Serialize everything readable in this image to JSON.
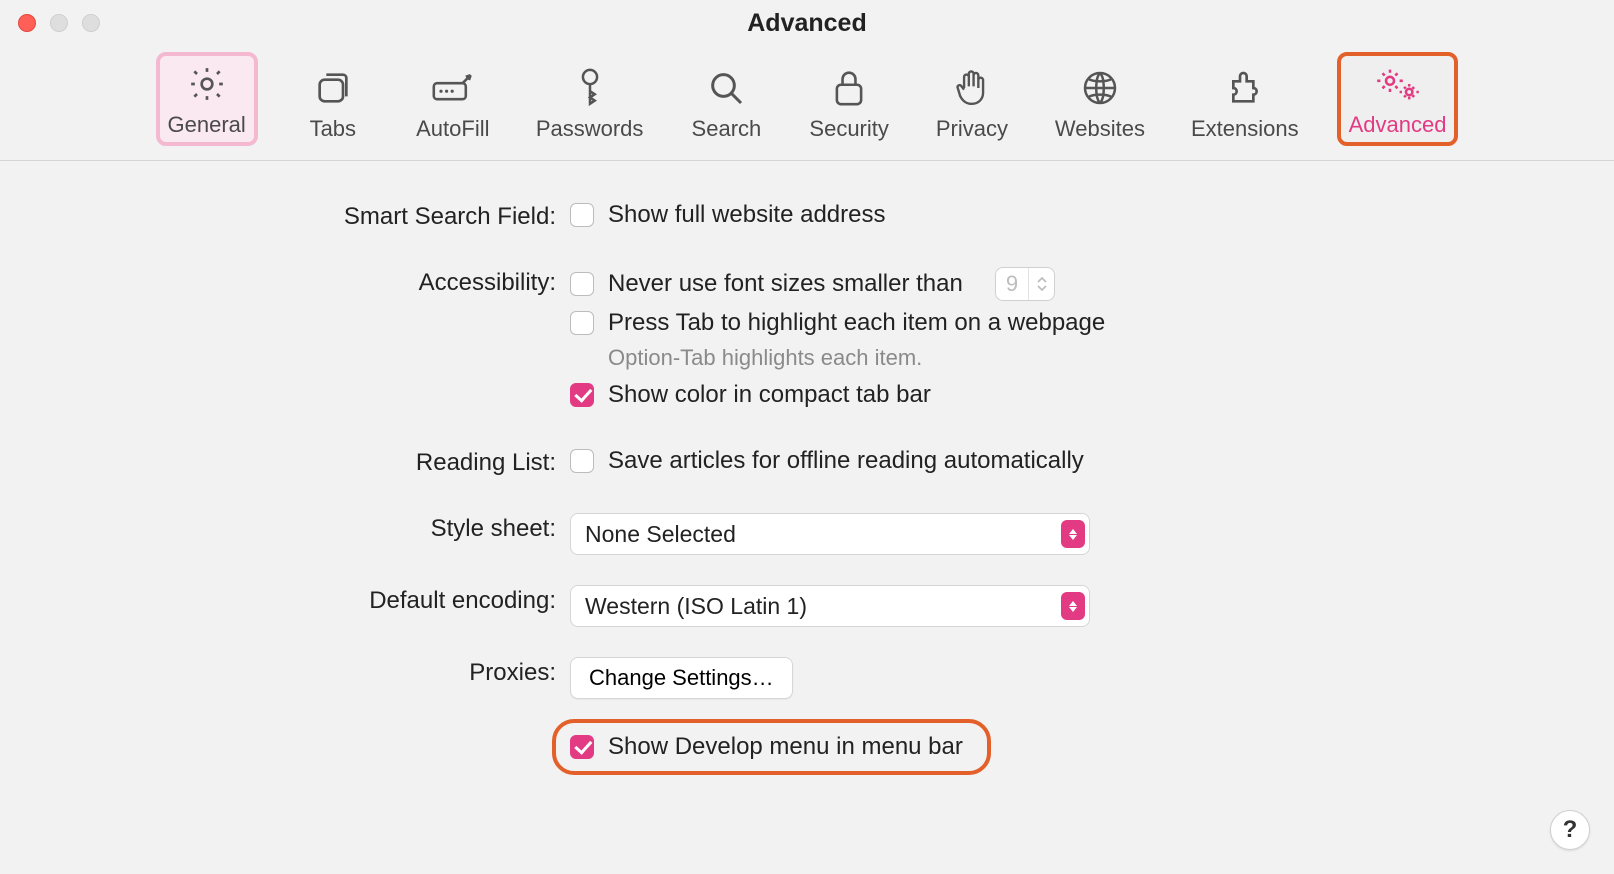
{
  "window": {
    "title": "Advanced"
  },
  "toolbar": {
    "items": [
      {
        "label": "General"
      },
      {
        "label": "Tabs"
      },
      {
        "label": "AutoFill"
      },
      {
        "label": "Passwords"
      },
      {
        "label": "Search"
      },
      {
        "label": "Security"
      },
      {
        "label": "Privacy"
      },
      {
        "label": "Websites"
      },
      {
        "label": "Extensions"
      },
      {
        "label": "Advanced"
      }
    ]
  },
  "sections": {
    "smart_search": {
      "label": "Smart Search Field:",
      "show_full_address": "Show full website address"
    },
    "accessibility": {
      "label": "Accessibility:",
      "never_smaller": "Never use font sizes smaller than",
      "font_size": "9",
      "press_tab": "Press Tab to highlight each item on a webpage",
      "hint": "Option-Tab highlights each item.",
      "show_color": "Show color in compact tab bar"
    },
    "reading_list": {
      "label": "Reading List:",
      "save_offline": "Save articles for offline reading automatically"
    },
    "style_sheet": {
      "label": "Style sheet:",
      "value": "None Selected"
    },
    "encoding": {
      "label": "Default encoding:",
      "value": "Western (ISO Latin 1)"
    },
    "proxies": {
      "label": "Proxies:",
      "button": "Change Settings…"
    },
    "develop": {
      "label": "Show Develop menu in menu bar"
    }
  },
  "help": "?"
}
